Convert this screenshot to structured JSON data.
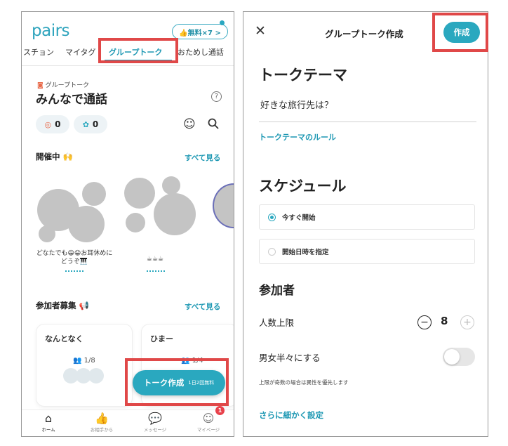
{
  "left": {
    "logo": "pairs",
    "free_pill": "👍無料×7 >",
    "tabs": [
      "スチョン",
      "マイタグ",
      "グループトーク",
      "おためし通話"
    ],
    "small_label": "グループトーク",
    "title": "みんなで通話",
    "help": "?",
    "chip1": "0",
    "chip2": "0",
    "live_heading": "開催中 🙌",
    "see_all": "すべて見る",
    "room1_caption": "どなたでも😀😀お耳休めにどうぞ🎹",
    "room2_caption": "☕☕☕",
    "recruit_heading": "参加者募集 📢",
    "see_all2": "すべて見る",
    "card1_title": "なんとなく",
    "card1_count": "1/8",
    "card2_title": "ひまー",
    "card2_count": "1/4",
    "talk_btn": "トーク作成",
    "talk_btn_sub": "1日2回無料",
    "nav": [
      "ホーム",
      "お相手から",
      "メッセージ",
      "マイページ"
    ],
    "badge": "1"
  },
  "right": {
    "title": "グループトーク作成",
    "create": "作成",
    "topic_heading": "トークテーマ",
    "topic_value": "好きな旅行先は？",
    "rule_link": "トークテーマのルール",
    "schedule_heading": "スケジュール",
    "opt_now": "今すぐ開始",
    "opt_date": "開始日時を指定",
    "participants_heading": "参加者",
    "limit_label": "人数上限",
    "limit_value": "8",
    "half_label": "男女半々にする",
    "note": "上限が奇数の場合は異性を優先します",
    "more_settings": "さらに細かく設定"
  },
  "colors": {
    "accent": "#2aa8bf",
    "highlight": "#e04848"
  }
}
